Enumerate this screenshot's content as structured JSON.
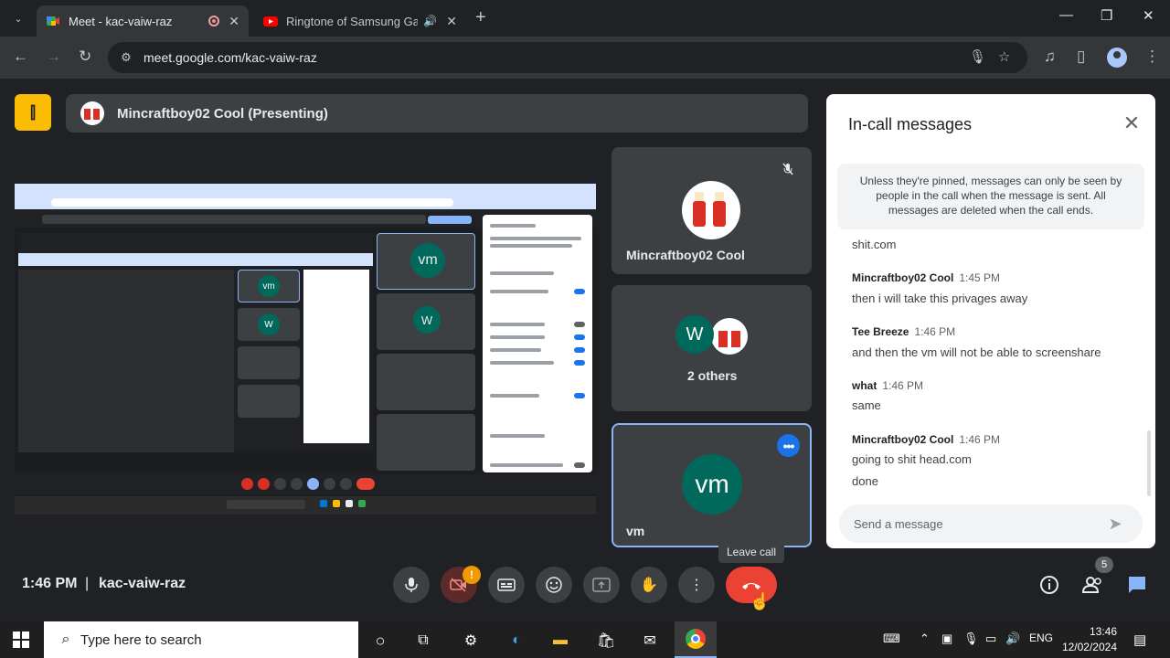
{
  "browser": {
    "tabs": [
      {
        "title": "Meet - kac-vaiw-raz",
        "active": true
      },
      {
        "title": "Ringtone of Samsung Galaxy",
        "active": false
      }
    ],
    "url": "meet.google.com/kac-vaiw-raz",
    "favicon_colors": {
      "meet": "#34a853",
      "youtube": "#ff0000"
    }
  },
  "meet": {
    "presentation_label": "Mincraftboy02 Cool (Presenting)",
    "participants": [
      {
        "name": "Mincraftboy02 Cool",
        "muted": true
      },
      {
        "name": "2 others",
        "initial": "W"
      },
      {
        "name": "vm",
        "initial": "vm",
        "highlighted": true
      }
    ],
    "shared_screen": {
      "inner_tiles": [
        "vm",
        "W"
      ]
    },
    "chat": {
      "title": "In-call messages",
      "notice": "Unless they're pinned, messages can only be seen by people in the call when the message is sent. All messages are deleted when the call ends.",
      "messages": [
        {
          "sender": "",
          "time": "",
          "text": "shit.com"
        },
        {
          "sender": "Mincraftboy02 Cool",
          "time": "1:45 PM",
          "text": "then i will take this privages away"
        },
        {
          "sender": "Tee Breeze",
          "time": "1:46 PM",
          "text": "and then the vm will not be able to screenshare"
        },
        {
          "sender": "what",
          "time": "1:46 PM",
          "text": "same"
        },
        {
          "sender": "Mincraftboy02 Cool",
          "time": "1:46 PM",
          "text": "going to shit head.com",
          "text2": "done"
        }
      ],
      "input_placeholder": "Send a message"
    },
    "bottom": {
      "time": "1:46 PM",
      "separator": "|",
      "meeting_code": "kac-vaiw-raz",
      "leave_tooltip": "Leave call",
      "people_count": "5",
      "camera_warning": "!"
    },
    "colors": {
      "accent": "#8ab4f8",
      "leave": "#ea4335",
      "avatar_teal": "#00695c"
    }
  },
  "taskbar": {
    "search_placeholder": "Type here to search",
    "language": "ENG",
    "time": "13:46",
    "date": "12/02/2024"
  }
}
